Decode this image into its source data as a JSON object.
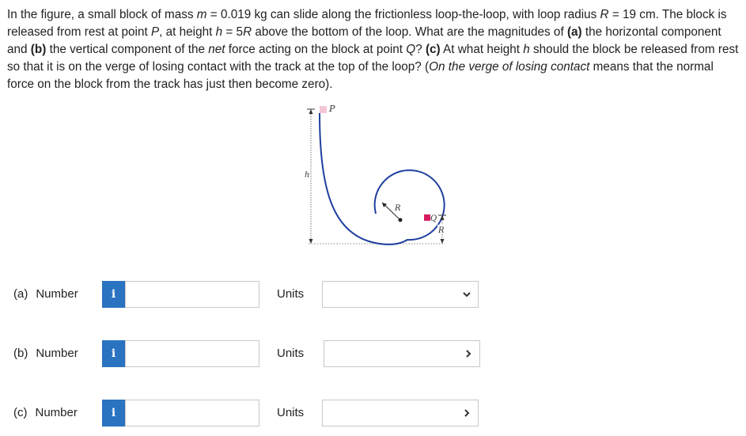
{
  "problem": {
    "p1": "In the figure, a small block of mass ",
    "m_var": "m",
    "p2": " = 0.019 kg can slide along the frictionless loop-the-loop, with loop radius ",
    "R_var": "R",
    "p3": " = 19 cm. The block is released from rest at point ",
    "P_var": "P",
    "p4": ", at height ",
    "h_var": "h",
    "p5": " = 5",
    "R_var2": "R",
    "p6": " above the bottom of the loop. What are the magnitudes of ",
    "a_tag": "(a)",
    "p7": " the horizontal component and ",
    "b_tag": "(b)",
    "p8": " the vertical component of the ",
    "net_word": "net",
    "p9": " force acting on the block at point ",
    "Q_var": "Q",
    "p10": "? ",
    "c_tag": "(c)",
    "p11": " At what height ",
    "h_var2": "h",
    "p12": " should the block be released from rest so that it is on the verge of losing contact with the track at the top of the loop? (",
    "verge_phrase": "On the verge of losing contact",
    "p13": " means that the normal force on the block from the track has just then become zero)."
  },
  "figure": {
    "label_P": "P",
    "label_h": "h",
    "label_R_radius": "R",
    "label_Q": "Q",
    "label_R_height": "R",
    "track_color": "#1f3f9f",
    "block_P_color": "#f3c6d6",
    "block_Q_color": "#d81b60"
  },
  "answers": [
    {
      "paren": "(a)",
      "label": "Number",
      "info_glyph": "i",
      "value": "",
      "units_label": "Units",
      "units_value": ""
    },
    {
      "paren": "(b)",
      "label": "Number",
      "info_glyph": "i",
      "value": "",
      "units_label": "Units",
      "units_value": ""
    },
    {
      "paren": "(c)",
      "label": "Number",
      "info_glyph": "i",
      "value": "",
      "units_label": "Units",
      "units_value": ""
    }
  ],
  "colors": {
    "info_button": "#2a73c1",
    "input_border": "#c8c8c8"
  }
}
